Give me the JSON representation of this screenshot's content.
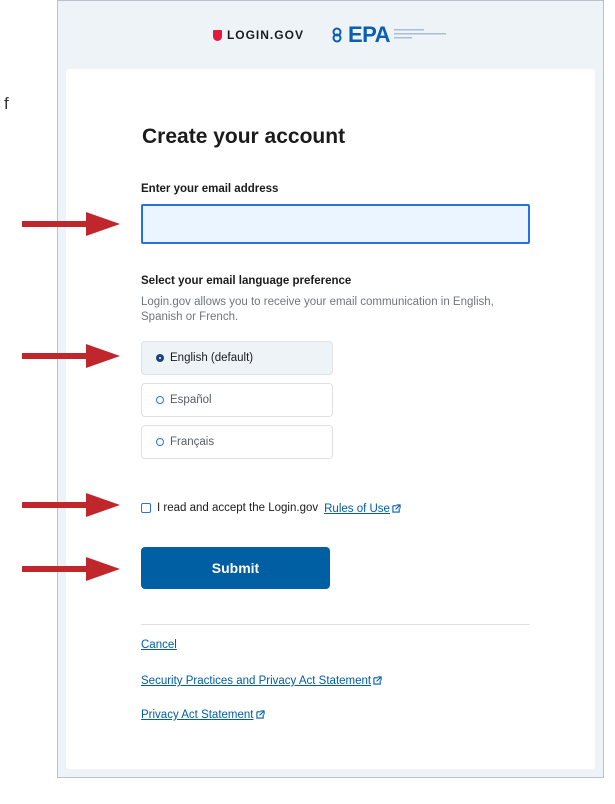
{
  "edge_text": "f",
  "header": {
    "login_logo_text": "LOGIN.GOV",
    "epa_logo_text": "EPA"
  },
  "form": {
    "title": "Create your account",
    "email_label": "Enter your email address",
    "email_value": "",
    "language_label": "Select your email language preference",
    "language_hint": "Login.gov allows you to receive your email communication in English, Spanish or French.",
    "language_options": [
      {
        "label": "English (default)",
        "selected": true
      },
      {
        "label": "Español",
        "selected": false
      },
      {
        "label": "Français",
        "selected": false
      }
    ],
    "rules_prefix": "I read and accept the Login.gov",
    "rules_link": "Rules of Use",
    "rules_checked": false,
    "submit_label": "Submit"
  },
  "footer": {
    "cancel": "Cancel",
    "security_link": "Security Practices and Privacy Act Statement",
    "privacy_link": "Privacy Act Statement"
  },
  "colors": {
    "arrow": "#c0272d",
    "primary": "#005ea2",
    "focus": "#2672de"
  },
  "icons": {
    "external_link": "external-link-icon",
    "annotation_arrow": "arrow-right-icon"
  }
}
